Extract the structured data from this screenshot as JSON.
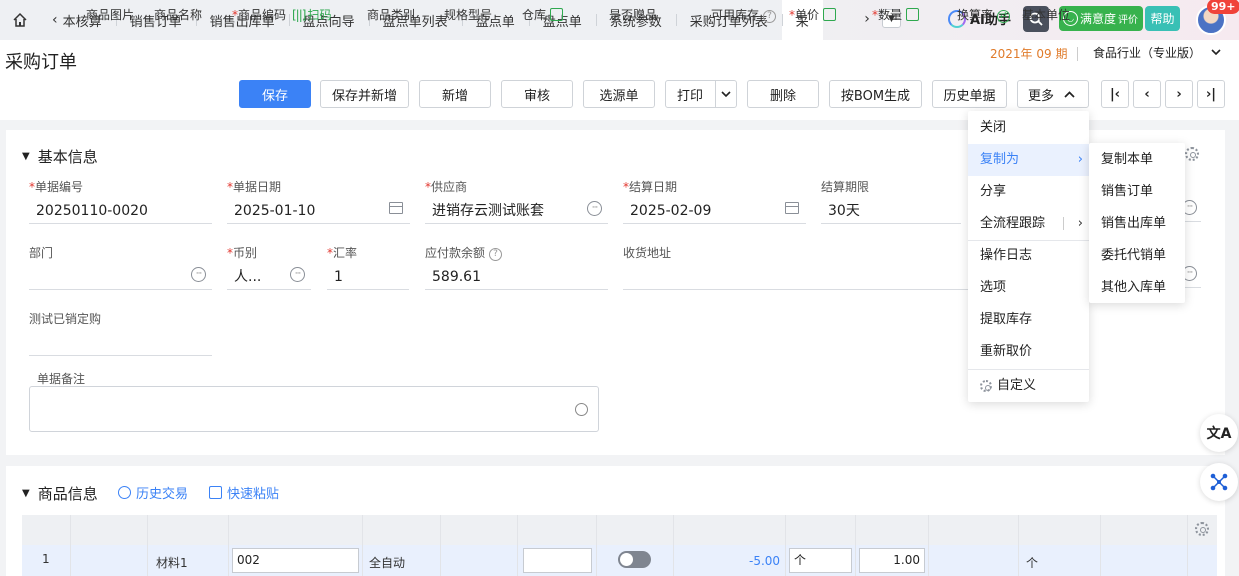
{
  "nav": {
    "tabs": [
      "本核算",
      "销售订单",
      "销售出库单",
      "盘点向导",
      "盘点单列表",
      "盘点单",
      "盘点单",
      "系统参数",
      "采购订单列表",
      "采"
    ],
    "ai_label": "AI助手",
    "satisfaction_label": "满意度",
    "satisfaction_sub": "评价",
    "help_label": "帮助",
    "badge": "99+"
  },
  "header": {
    "title": "采购订单",
    "period": "2021年 09 期",
    "industry": "食品行业（专业版）"
  },
  "toolbar": {
    "save": "保存",
    "save_new": "保存并新增",
    "add": "新增",
    "audit": "审核",
    "source": "选源单",
    "print": "打印",
    "delete": "删除",
    "bom": "按BOM生成",
    "history": "历史单据",
    "more": "更多"
  },
  "basic": {
    "title": "基本信息",
    "doc_no_label": "单据编号",
    "doc_no": "20250110-0020",
    "doc_date_label": "单据日期",
    "doc_date": "2025-01-10",
    "supplier_label": "供应商",
    "supplier": "进销存云测试账套",
    "settle_date_label": "结算日期",
    "settle_date": "2025-02-09",
    "settle_term_label": "结算期限",
    "settle_term": "30天",
    "dept_label": "部门",
    "dept": "",
    "currency_label": "币别",
    "currency": "人...",
    "rate_label": "汇率",
    "rate": "1",
    "payable_label": "应付款余额",
    "payable": "589.61",
    "address_label": "收货地址",
    "test_label": "测试已销定购",
    "memo_label": "单据备注"
  },
  "menu": {
    "items": [
      "关闭",
      "复制为",
      "分享",
      "全流程跟踪",
      "操作日志",
      "选项",
      "提取库存",
      "重新取价",
      "自定义"
    ],
    "sub": [
      "复制本单",
      "销售订单",
      "销售出库单",
      "委托代销单",
      "其他入库单"
    ]
  },
  "goods": {
    "title": "商品信息",
    "history_link": "历史交易",
    "paste_link": "快速粘贴",
    "columns": {
      "image": "商品图片",
      "name": "商品名称",
      "code": "商品编码",
      "scan": "扫码",
      "category": "商品类别",
      "spec": "规格型号",
      "warehouse": "仓库",
      "gift": "是否赠品",
      "stock": "可用库存",
      "unit_price": "单价",
      "qty": "数量",
      "rate": "换算率",
      "base_unit": "基本单位"
    },
    "rows": [
      {
        "index": "1",
        "name": "材料1",
        "code": "002",
        "category": "全自动",
        "stock": "-5.00",
        "unit": "个",
        "qty": "1.00",
        "base_unit": "个"
      }
    ]
  }
}
